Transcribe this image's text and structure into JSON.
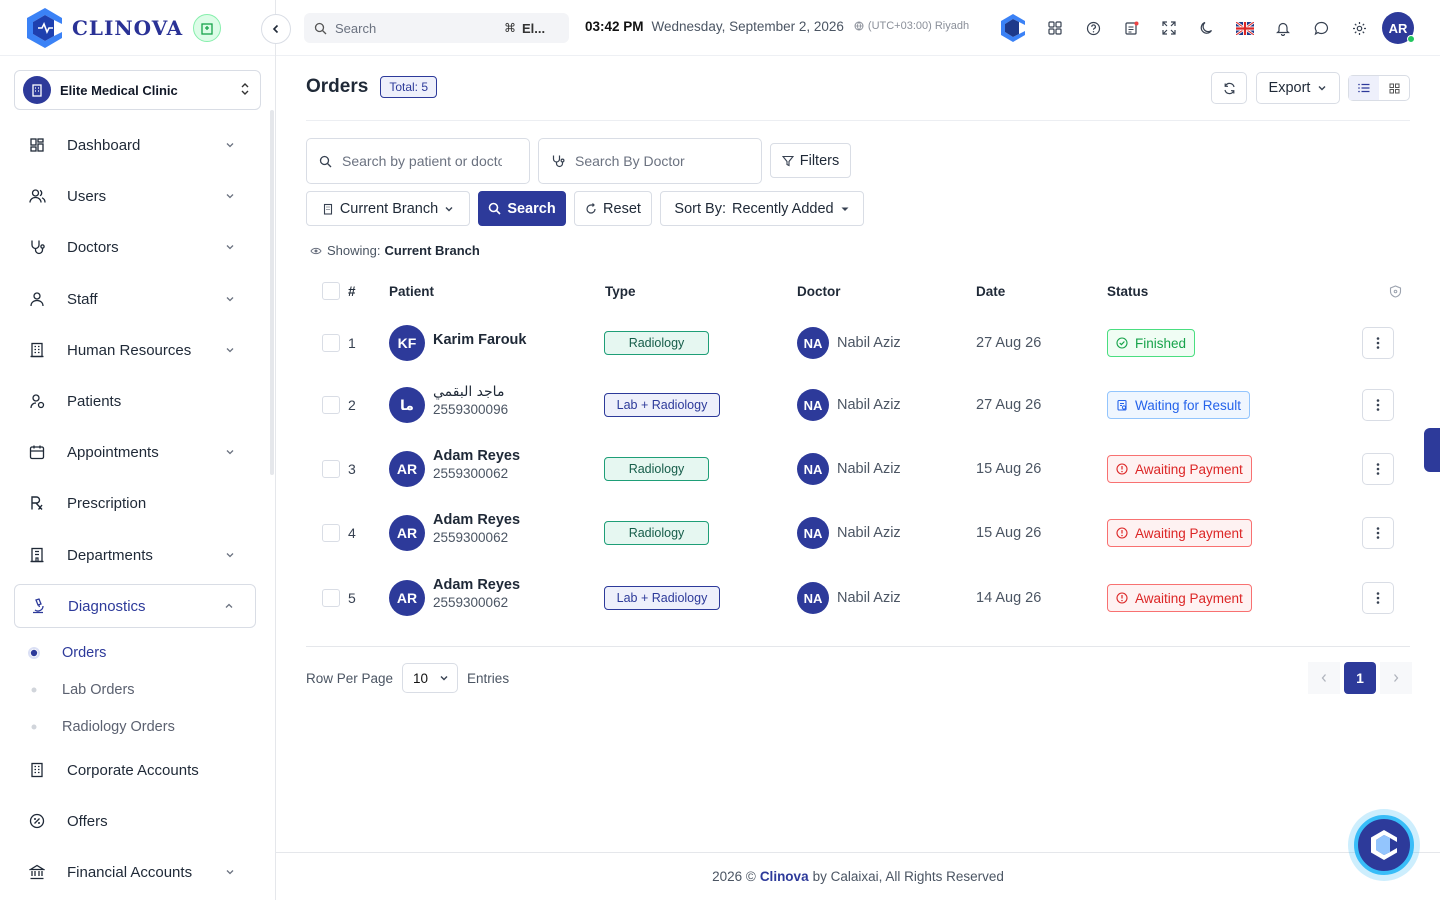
{
  "brand": {
    "name": "CLINOVA"
  },
  "clinic": {
    "name": "Elite Medical Clinic"
  },
  "sidebar": {
    "items": [
      {
        "label": "Dashboard",
        "icon": "dashboard-icon",
        "chevron": true
      },
      {
        "label": "Users",
        "icon": "users-icon",
        "chevron": true
      },
      {
        "label": "Doctors",
        "icon": "stethoscope-icon",
        "chevron": true
      },
      {
        "label": "Staff",
        "icon": "staff-icon",
        "chevron": true
      },
      {
        "label": "Human Resources",
        "icon": "building-icon",
        "chevron": true
      },
      {
        "label": "Patients",
        "icon": "patient-icon",
        "chevron": false
      },
      {
        "label": "Appointments",
        "icon": "calendar-icon",
        "chevron": true
      },
      {
        "label": "Prescription",
        "icon": "prescription-icon",
        "chevron": false
      },
      {
        "label": "Departments",
        "icon": "departments-icon",
        "chevron": true
      },
      {
        "label": "Diagnostics",
        "icon": "microscope-icon",
        "chevron": true,
        "expanded": true
      },
      {
        "label": "Corporate Accounts",
        "icon": "corporate-icon",
        "chevron": false
      },
      {
        "label": "Offers",
        "icon": "offers-icon",
        "chevron": false
      },
      {
        "label": "Financial Accounts",
        "icon": "bank-icon",
        "chevron": true
      }
    ],
    "sub_items": [
      {
        "label": "Orders",
        "active": true
      },
      {
        "label": "Lab Orders",
        "active": false
      },
      {
        "label": "Radiology Orders",
        "active": false
      }
    ]
  },
  "topbar": {
    "search_placeholder": "Search",
    "shortcut_symbol": "⌘",
    "shortcut_text": "El...",
    "time": "03:42 PM",
    "date": "Wednesday, September 2, 2026",
    "timezone": "(UTC+03:00) Riyadh",
    "user_initials": "AR"
  },
  "page": {
    "title": "Orders",
    "total_badge": "Total: 5",
    "export_label": "Export"
  },
  "filters": {
    "patient_placeholder": "Search by patient or doctor",
    "doctor_placeholder": "Search By Doctor",
    "filters_label": "Filters",
    "branch_label": "Current Branch",
    "search_label": "Search",
    "reset_label": "Reset",
    "sort_prefix": "Sort By:",
    "sort_value": "Recently Added"
  },
  "showing": {
    "prefix": "Showing:",
    "value": "Current Branch"
  },
  "table": {
    "headers": {
      "num": "#",
      "patient": "Patient",
      "type": "Type",
      "doctor": "Doctor",
      "date": "Date",
      "status": "Status"
    },
    "rows": [
      {
        "num": "1",
        "initials": "KF",
        "name": "Karim Farouk",
        "pid": "",
        "type": "Radiology",
        "type_kind": "rad",
        "doc_initials": "NA",
        "doctor": "Nabil Aziz",
        "date": "27 Aug 26",
        "status": "Finished",
        "status_kind": "finished"
      },
      {
        "num": "2",
        "initials": "ما",
        "name": "ماجد البقمي",
        "pid": "2559300096",
        "type": "Lab + Radiology",
        "type_kind": "lab",
        "doc_initials": "NA",
        "doctor": "Nabil Aziz",
        "date": "27 Aug 26",
        "status": "Waiting for Result",
        "status_kind": "waiting"
      },
      {
        "num": "3",
        "initials": "AR",
        "name": "Adam Reyes",
        "pid": "2559300062",
        "type": "Radiology",
        "type_kind": "rad",
        "doc_initials": "NA",
        "doctor": "Nabil Aziz",
        "date": "15 Aug 26",
        "status": "Awaiting Payment",
        "status_kind": "awaiting"
      },
      {
        "num": "4",
        "initials": "AR",
        "name": "Adam Reyes",
        "pid": "2559300062",
        "type": "Radiology",
        "type_kind": "rad",
        "doc_initials": "NA",
        "doctor": "Nabil Aziz",
        "date": "15 Aug 26",
        "status": "Awaiting Payment",
        "status_kind": "awaiting"
      },
      {
        "num": "5",
        "initials": "AR",
        "name": "Adam Reyes",
        "pid": "2559300062",
        "type": "Lab + Radiology",
        "type_kind": "lab",
        "doc_initials": "NA",
        "doctor": "Nabil Aziz",
        "date": "14 Aug 26",
        "status": "Awaiting Payment",
        "status_kind": "awaiting"
      }
    ]
  },
  "pagination": {
    "rows_label": "Row Per Page",
    "rows_value": "10",
    "entries_label": "Entries",
    "current_page": "1"
  },
  "footer": {
    "prefix": "2026 ©",
    "brand": "Clinova",
    "suffix": "by Calaixai, All Rights Reserved"
  },
  "colors": {
    "primary": "#2d3a9a",
    "success": "#16a34a",
    "info": "#2563eb",
    "danger": "#dc2626"
  }
}
